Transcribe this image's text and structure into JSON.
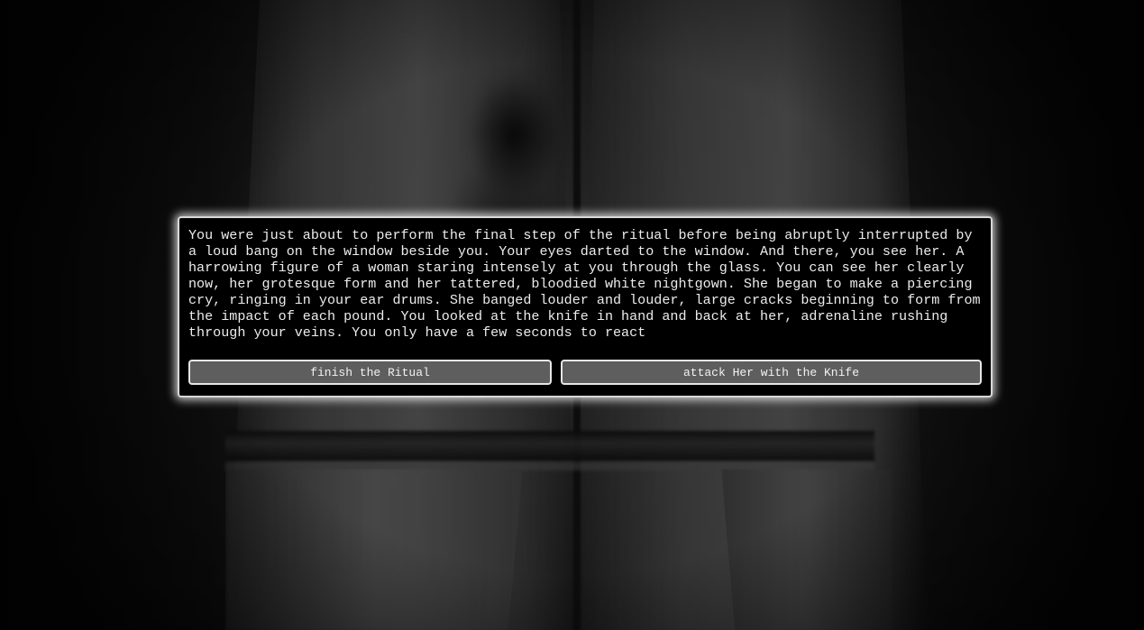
{
  "story": {
    "text": "You were just about to perform the final step of the ritual before being abruptly interrupted by a loud bang on the window beside you. Your eyes darted to the window. And there, you see her. A harrowing figure of a woman staring intensely at you through the glass. You can see her clearly now, her grotesque form and her tattered, bloodied white nightgown. She began to make a piercing cry, ringing in your ear drums. She banged louder and louder, large cracks beginning to form from the impact of each pound. You looked at the knife in hand and back at her, adrenaline rushing through your veins. You only have a few seconds to react"
  },
  "choices": [
    {
      "label": "finish the Ritual"
    },
    {
      "label": "attack Her with the Knife"
    }
  ],
  "colors": {
    "dialog_background": "#000000",
    "dialog_border": "#d8d8d8",
    "button_background": "#5e5e5e",
    "text": "#ececec"
  }
}
